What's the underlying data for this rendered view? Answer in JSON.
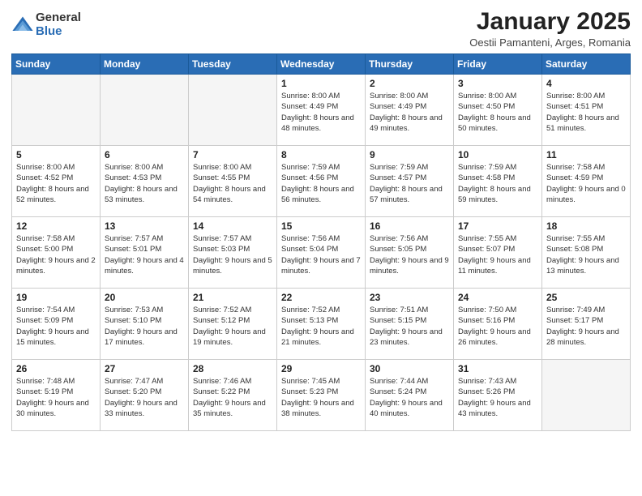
{
  "logo": {
    "general": "General",
    "blue": "Blue"
  },
  "header": {
    "title": "January 2025",
    "subtitle": "Oestii Pamanteni, Arges, Romania"
  },
  "weekdays": [
    "Sunday",
    "Monday",
    "Tuesday",
    "Wednesday",
    "Thursday",
    "Friday",
    "Saturday"
  ],
  "weeks": [
    [
      {
        "day": "",
        "sunrise": "",
        "sunset": "",
        "daylight": ""
      },
      {
        "day": "",
        "sunrise": "",
        "sunset": "",
        "daylight": ""
      },
      {
        "day": "",
        "sunrise": "",
        "sunset": "",
        "daylight": ""
      },
      {
        "day": "1",
        "sunrise": "Sunrise: 8:00 AM",
        "sunset": "Sunset: 4:49 PM",
        "daylight": "Daylight: 8 hours and 48 minutes."
      },
      {
        "day": "2",
        "sunrise": "Sunrise: 8:00 AM",
        "sunset": "Sunset: 4:49 PM",
        "daylight": "Daylight: 8 hours and 49 minutes."
      },
      {
        "day": "3",
        "sunrise": "Sunrise: 8:00 AM",
        "sunset": "Sunset: 4:50 PM",
        "daylight": "Daylight: 8 hours and 50 minutes."
      },
      {
        "day": "4",
        "sunrise": "Sunrise: 8:00 AM",
        "sunset": "Sunset: 4:51 PM",
        "daylight": "Daylight: 8 hours and 51 minutes."
      }
    ],
    [
      {
        "day": "5",
        "sunrise": "Sunrise: 8:00 AM",
        "sunset": "Sunset: 4:52 PM",
        "daylight": "Daylight: 8 hours and 52 minutes."
      },
      {
        "day": "6",
        "sunrise": "Sunrise: 8:00 AM",
        "sunset": "Sunset: 4:53 PM",
        "daylight": "Daylight: 8 hours and 53 minutes."
      },
      {
        "day": "7",
        "sunrise": "Sunrise: 8:00 AM",
        "sunset": "Sunset: 4:55 PM",
        "daylight": "Daylight: 8 hours and 54 minutes."
      },
      {
        "day": "8",
        "sunrise": "Sunrise: 7:59 AM",
        "sunset": "Sunset: 4:56 PM",
        "daylight": "Daylight: 8 hours and 56 minutes."
      },
      {
        "day": "9",
        "sunrise": "Sunrise: 7:59 AM",
        "sunset": "Sunset: 4:57 PM",
        "daylight": "Daylight: 8 hours and 57 minutes."
      },
      {
        "day": "10",
        "sunrise": "Sunrise: 7:59 AM",
        "sunset": "Sunset: 4:58 PM",
        "daylight": "Daylight: 8 hours and 59 minutes."
      },
      {
        "day": "11",
        "sunrise": "Sunrise: 7:58 AM",
        "sunset": "Sunset: 4:59 PM",
        "daylight": "Daylight: 9 hours and 0 minutes."
      }
    ],
    [
      {
        "day": "12",
        "sunrise": "Sunrise: 7:58 AM",
        "sunset": "Sunset: 5:00 PM",
        "daylight": "Daylight: 9 hours and 2 minutes."
      },
      {
        "day": "13",
        "sunrise": "Sunrise: 7:57 AM",
        "sunset": "Sunset: 5:01 PM",
        "daylight": "Daylight: 9 hours and 4 minutes."
      },
      {
        "day": "14",
        "sunrise": "Sunrise: 7:57 AM",
        "sunset": "Sunset: 5:03 PM",
        "daylight": "Daylight: 9 hours and 5 minutes."
      },
      {
        "day": "15",
        "sunrise": "Sunrise: 7:56 AM",
        "sunset": "Sunset: 5:04 PM",
        "daylight": "Daylight: 9 hours and 7 minutes."
      },
      {
        "day": "16",
        "sunrise": "Sunrise: 7:56 AM",
        "sunset": "Sunset: 5:05 PM",
        "daylight": "Daylight: 9 hours and 9 minutes."
      },
      {
        "day": "17",
        "sunrise": "Sunrise: 7:55 AM",
        "sunset": "Sunset: 5:07 PM",
        "daylight": "Daylight: 9 hours and 11 minutes."
      },
      {
        "day": "18",
        "sunrise": "Sunrise: 7:55 AM",
        "sunset": "Sunset: 5:08 PM",
        "daylight": "Daylight: 9 hours and 13 minutes."
      }
    ],
    [
      {
        "day": "19",
        "sunrise": "Sunrise: 7:54 AM",
        "sunset": "Sunset: 5:09 PM",
        "daylight": "Daylight: 9 hours and 15 minutes."
      },
      {
        "day": "20",
        "sunrise": "Sunrise: 7:53 AM",
        "sunset": "Sunset: 5:10 PM",
        "daylight": "Daylight: 9 hours and 17 minutes."
      },
      {
        "day": "21",
        "sunrise": "Sunrise: 7:52 AM",
        "sunset": "Sunset: 5:12 PM",
        "daylight": "Daylight: 9 hours and 19 minutes."
      },
      {
        "day": "22",
        "sunrise": "Sunrise: 7:52 AM",
        "sunset": "Sunset: 5:13 PM",
        "daylight": "Daylight: 9 hours and 21 minutes."
      },
      {
        "day": "23",
        "sunrise": "Sunrise: 7:51 AM",
        "sunset": "Sunset: 5:15 PM",
        "daylight": "Daylight: 9 hours and 23 minutes."
      },
      {
        "day": "24",
        "sunrise": "Sunrise: 7:50 AM",
        "sunset": "Sunset: 5:16 PM",
        "daylight": "Daylight: 9 hours and 26 minutes."
      },
      {
        "day": "25",
        "sunrise": "Sunrise: 7:49 AM",
        "sunset": "Sunset: 5:17 PM",
        "daylight": "Daylight: 9 hours and 28 minutes."
      }
    ],
    [
      {
        "day": "26",
        "sunrise": "Sunrise: 7:48 AM",
        "sunset": "Sunset: 5:19 PM",
        "daylight": "Daylight: 9 hours and 30 minutes."
      },
      {
        "day": "27",
        "sunrise": "Sunrise: 7:47 AM",
        "sunset": "Sunset: 5:20 PM",
        "daylight": "Daylight: 9 hours and 33 minutes."
      },
      {
        "day": "28",
        "sunrise": "Sunrise: 7:46 AM",
        "sunset": "Sunset: 5:22 PM",
        "daylight": "Daylight: 9 hours and 35 minutes."
      },
      {
        "day": "29",
        "sunrise": "Sunrise: 7:45 AM",
        "sunset": "Sunset: 5:23 PM",
        "daylight": "Daylight: 9 hours and 38 minutes."
      },
      {
        "day": "30",
        "sunrise": "Sunrise: 7:44 AM",
        "sunset": "Sunset: 5:24 PM",
        "daylight": "Daylight: 9 hours and 40 minutes."
      },
      {
        "day": "31",
        "sunrise": "Sunrise: 7:43 AM",
        "sunset": "Sunset: 5:26 PM",
        "daylight": "Daylight: 9 hours and 43 minutes."
      },
      {
        "day": "",
        "sunrise": "",
        "sunset": "",
        "daylight": ""
      }
    ]
  ]
}
